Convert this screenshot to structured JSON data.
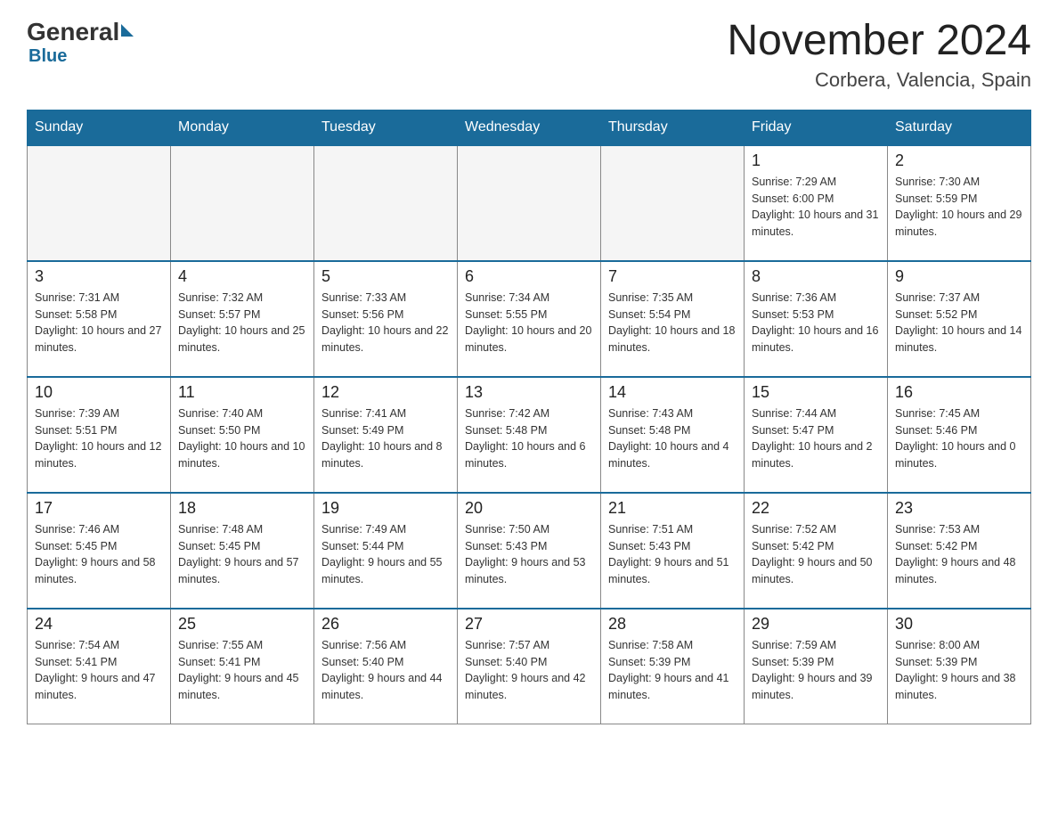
{
  "header": {
    "logo_general": "General",
    "logo_blue": "Blue",
    "month_title": "November 2024",
    "location": "Corbera, Valencia, Spain"
  },
  "weekdays": [
    "Sunday",
    "Monday",
    "Tuesday",
    "Wednesday",
    "Thursday",
    "Friday",
    "Saturday"
  ],
  "weeks": [
    [
      {
        "day": "",
        "sunrise": "",
        "sunset": "",
        "daylight": "",
        "empty": true
      },
      {
        "day": "",
        "sunrise": "",
        "sunset": "",
        "daylight": "",
        "empty": true
      },
      {
        "day": "",
        "sunrise": "",
        "sunset": "",
        "daylight": "",
        "empty": true
      },
      {
        "day": "",
        "sunrise": "",
        "sunset": "",
        "daylight": "",
        "empty": true
      },
      {
        "day": "",
        "sunrise": "",
        "sunset": "",
        "daylight": "",
        "empty": true
      },
      {
        "day": "1",
        "sunrise": "Sunrise: 7:29 AM",
        "sunset": "Sunset: 6:00 PM",
        "daylight": "Daylight: 10 hours and 31 minutes.",
        "empty": false
      },
      {
        "day": "2",
        "sunrise": "Sunrise: 7:30 AM",
        "sunset": "Sunset: 5:59 PM",
        "daylight": "Daylight: 10 hours and 29 minutes.",
        "empty": false
      }
    ],
    [
      {
        "day": "3",
        "sunrise": "Sunrise: 7:31 AM",
        "sunset": "Sunset: 5:58 PM",
        "daylight": "Daylight: 10 hours and 27 minutes.",
        "empty": false
      },
      {
        "day": "4",
        "sunrise": "Sunrise: 7:32 AM",
        "sunset": "Sunset: 5:57 PM",
        "daylight": "Daylight: 10 hours and 25 minutes.",
        "empty": false
      },
      {
        "day": "5",
        "sunrise": "Sunrise: 7:33 AM",
        "sunset": "Sunset: 5:56 PM",
        "daylight": "Daylight: 10 hours and 22 minutes.",
        "empty": false
      },
      {
        "day": "6",
        "sunrise": "Sunrise: 7:34 AM",
        "sunset": "Sunset: 5:55 PM",
        "daylight": "Daylight: 10 hours and 20 minutes.",
        "empty": false
      },
      {
        "day": "7",
        "sunrise": "Sunrise: 7:35 AM",
        "sunset": "Sunset: 5:54 PM",
        "daylight": "Daylight: 10 hours and 18 minutes.",
        "empty": false
      },
      {
        "day": "8",
        "sunrise": "Sunrise: 7:36 AM",
        "sunset": "Sunset: 5:53 PM",
        "daylight": "Daylight: 10 hours and 16 minutes.",
        "empty": false
      },
      {
        "day": "9",
        "sunrise": "Sunrise: 7:37 AM",
        "sunset": "Sunset: 5:52 PM",
        "daylight": "Daylight: 10 hours and 14 minutes.",
        "empty": false
      }
    ],
    [
      {
        "day": "10",
        "sunrise": "Sunrise: 7:39 AM",
        "sunset": "Sunset: 5:51 PM",
        "daylight": "Daylight: 10 hours and 12 minutes.",
        "empty": false
      },
      {
        "day": "11",
        "sunrise": "Sunrise: 7:40 AM",
        "sunset": "Sunset: 5:50 PM",
        "daylight": "Daylight: 10 hours and 10 minutes.",
        "empty": false
      },
      {
        "day": "12",
        "sunrise": "Sunrise: 7:41 AM",
        "sunset": "Sunset: 5:49 PM",
        "daylight": "Daylight: 10 hours and 8 minutes.",
        "empty": false
      },
      {
        "day": "13",
        "sunrise": "Sunrise: 7:42 AM",
        "sunset": "Sunset: 5:48 PM",
        "daylight": "Daylight: 10 hours and 6 minutes.",
        "empty": false
      },
      {
        "day": "14",
        "sunrise": "Sunrise: 7:43 AM",
        "sunset": "Sunset: 5:48 PM",
        "daylight": "Daylight: 10 hours and 4 minutes.",
        "empty": false
      },
      {
        "day": "15",
        "sunrise": "Sunrise: 7:44 AM",
        "sunset": "Sunset: 5:47 PM",
        "daylight": "Daylight: 10 hours and 2 minutes.",
        "empty": false
      },
      {
        "day": "16",
        "sunrise": "Sunrise: 7:45 AM",
        "sunset": "Sunset: 5:46 PM",
        "daylight": "Daylight: 10 hours and 0 minutes.",
        "empty": false
      }
    ],
    [
      {
        "day": "17",
        "sunrise": "Sunrise: 7:46 AM",
        "sunset": "Sunset: 5:45 PM",
        "daylight": "Daylight: 9 hours and 58 minutes.",
        "empty": false
      },
      {
        "day": "18",
        "sunrise": "Sunrise: 7:48 AM",
        "sunset": "Sunset: 5:45 PM",
        "daylight": "Daylight: 9 hours and 57 minutes.",
        "empty": false
      },
      {
        "day": "19",
        "sunrise": "Sunrise: 7:49 AM",
        "sunset": "Sunset: 5:44 PM",
        "daylight": "Daylight: 9 hours and 55 minutes.",
        "empty": false
      },
      {
        "day": "20",
        "sunrise": "Sunrise: 7:50 AM",
        "sunset": "Sunset: 5:43 PM",
        "daylight": "Daylight: 9 hours and 53 minutes.",
        "empty": false
      },
      {
        "day": "21",
        "sunrise": "Sunrise: 7:51 AM",
        "sunset": "Sunset: 5:43 PM",
        "daylight": "Daylight: 9 hours and 51 minutes.",
        "empty": false
      },
      {
        "day": "22",
        "sunrise": "Sunrise: 7:52 AM",
        "sunset": "Sunset: 5:42 PM",
        "daylight": "Daylight: 9 hours and 50 minutes.",
        "empty": false
      },
      {
        "day": "23",
        "sunrise": "Sunrise: 7:53 AM",
        "sunset": "Sunset: 5:42 PM",
        "daylight": "Daylight: 9 hours and 48 minutes.",
        "empty": false
      }
    ],
    [
      {
        "day": "24",
        "sunrise": "Sunrise: 7:54 AM",
        "sunset": "Sunset: 5:41 PM",
        "daylight": "Daylight: 9 hours and 47 minutes.",
        "empty": false
      },
      {
        "day": "25",
        "sunrise": "Sunrise: 7:55 AM",
        "sunset": "Sunset: 5:41 PM",
        "daylight": "Daylight: 9 hours and 45 minutes.",
        "empty": false
      },
      {
        "day": "26",
        "sunrise": "Sunrise: 7:56 AM",
        "sunset": "Sunset: 5:40 PM",
        "daylight": "Daylight: 9 hours and 44 minutes.",
        "empty": false
      },
      {
        "day": "27",
        "sunrise": "Sunrise: 7:57 AM",
        "sunset": "Sunset: 5:40 PM",
        "daylight": "Daylight: 9 hours and 42 minutes.",
        "empty": false
      },
      {
        "day": "28",
        "sunrise": "Sunrise: 7:58 AM",
        "sunset": "Sunset: 5:39 PM",
        "daylight": "Daylight: 9 hours and 41 minutes.",
        "empty": false
      },
      {
        "day": "29",
        "sunrise": "Sunrise: 7:59 AM",
        "sunset": "Sunset: 5:39 PM",
        "daylight": "Daylight: 9 hours and 39 minutes.",
        "empty": false
      },
      {
        "day": "30",
        "sunrise": "Sunrise: 8:00 AM",
        "sunset": "Sunset: 5:39 PM",
        "daylight": "Daylight: 9 hours and 38 minutes.",
        "empty": false
      }
    ]
  ]
}
